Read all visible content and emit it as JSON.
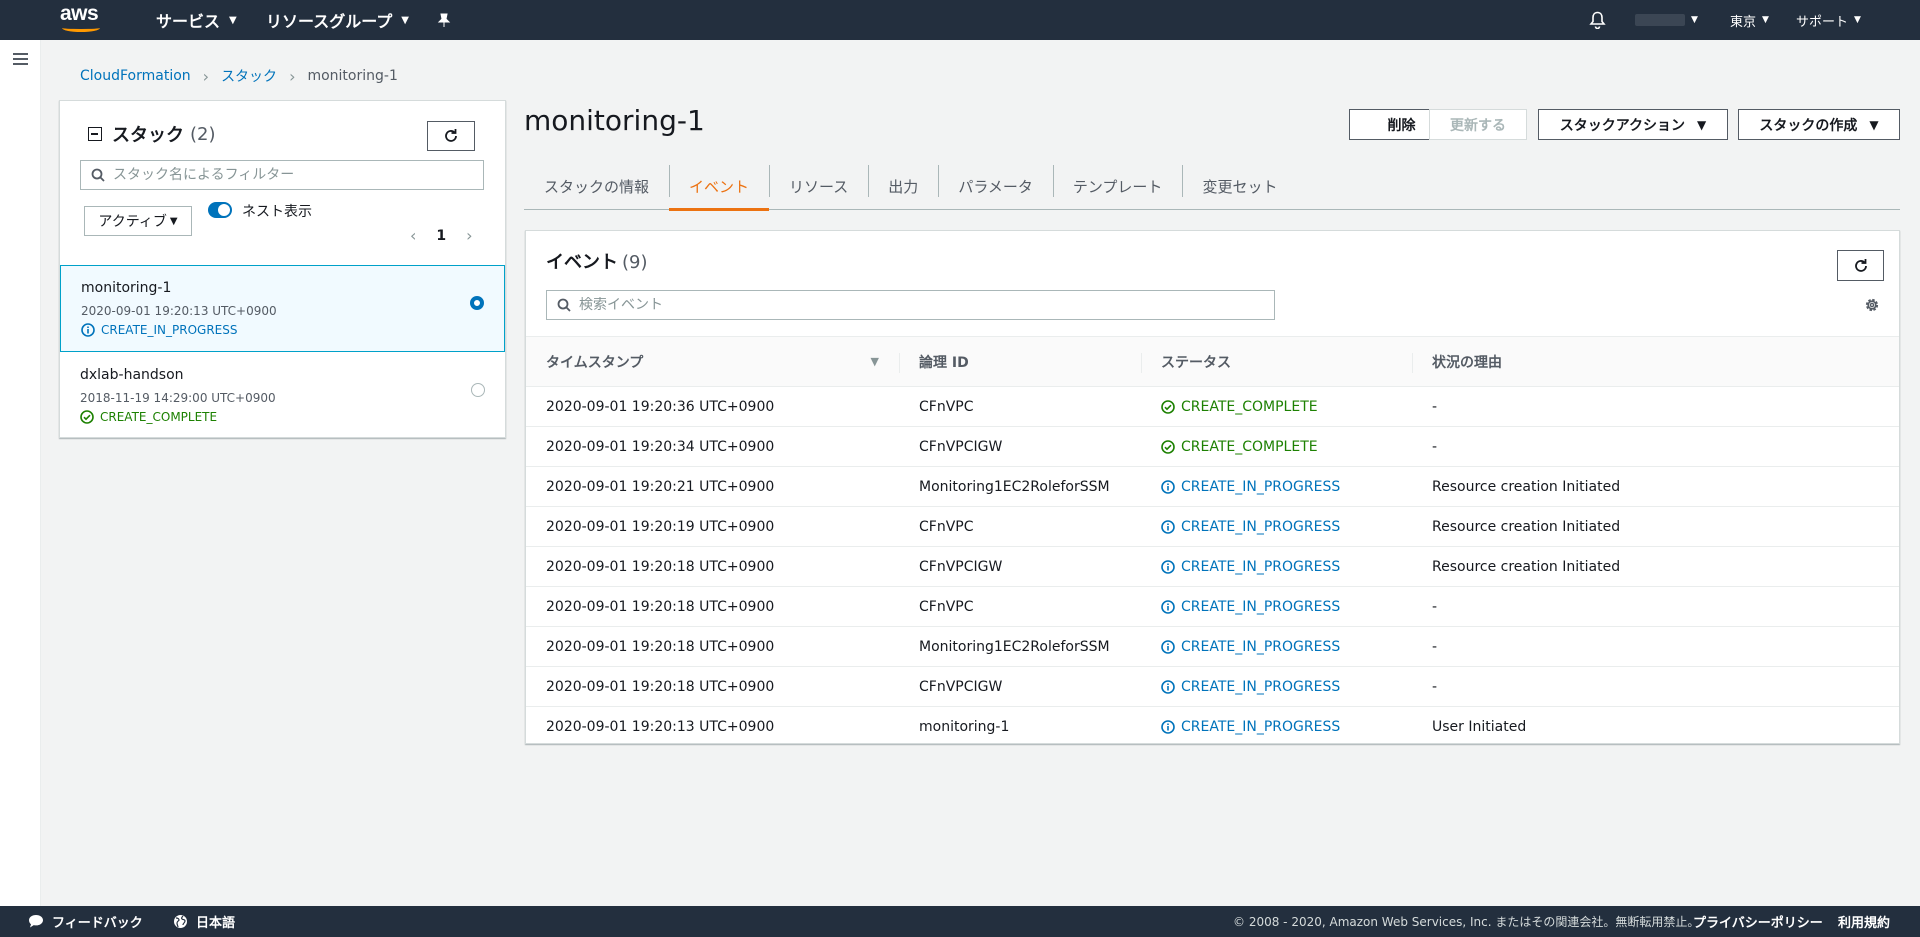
{
  "topnav": {
    "logo_text": "aws",
    "services": "サービス",
    "resource_groups": "リソースグループ",
    "account": "",
    "region": "東京",
    "support": "サポート"
  },
  "breadcrumb": {
    "root": "CloudFormation",
    "stacks": "スタック",
    "current": "monitoring-1"
  },
  "stacks_panel": {
    "title": "スタック",
    "count": "(2)",
    "search_placeholder": "スタック名によるフィルター",
    "filter_label": "アクティブ",
    "nested_label": "ネスト表示",
    "page": "1",
    "items": [
      {
        "name": "monitoring-1",
        "timestamp": "2020-09-01 19:20:13 UTC+0900",
        "status": "CREATE_IN_PROGRESS"
      },
      {
        "name": "dxlab-handson",
        "timestamp": "2018-11-19 14:29:00 UTC+0900",
        "status": "CREATE_COMPLETE"
      }
    ]
  },
  "main": {
    "title": "monitoring-1",
    "buttons": {
      "delete": "削除",
      "update": "更新する",
      "stack_actions": "スタックアクション",
      "create_stack": "スタックの作成"
    },
    "tabs": [
      "スタックの情報",
      "イベント",
      "リソース",
      "出力",
      "パラメータ",
      "テンプレート",
      "変更セット"
    ],
    "active_tab": "イベント"
  },
  "events": {
    "title": "イベント",
    "count": "(9)",
    "search_placeholder": "検索イベント",
    "columns": [
      "タイムスタンプ",
      "論理 ID",
      "ステータス",
      "状況の理由"
    ],
    "rows": [
      {
        "timestamp": "2020-09-01 19:20:36 UTC+0900",
        "logical_id": "CFnVPC",
        "status": "CREATE_COMPLETE",
        "reason": "-"
      },
      {
        "timestamp": "2020-09-01 19:20:34 UTC+0900",
        "logical_id": "CFnVPCIGW",
        "status": "CREATE_COMPLETE",
        "reason": "-"
      },
      {
        "timestamp": "2020-09-01 19:20:21 UTC+0900",
        "logical_id": "Monitoring1EC2RoleforSSM",
        "status": "CREATE_IN_PROGRESS",
        "reason": "Resource creation Initiated"
      },
      {
        "timestamp": "2020-09-01 19:20:19 UTC+0900",
        "logical_id": "CFnVPC",
        "status": "CREATE_IN_PROGRESS",
        "reason": "Resource creation Initiated"
      },
      {
        "timestamp": "2020-09-01 19:20:18 UTC+0900",
        "logical_id": "CFnVPCIGW",
        "status": "CREATE_IN_PROGRESS",
        "reason": "Resource creation Initiated"
      },
      {
        "timestamp": "2020-09-01 19:20:18 UTC+0900",
        "logical_id": "CFnVPC",
        "status": "CREATE_IN_PROGRESS",
        "reason": "-"
      },
      {
        "timestamp": "2020-09-01 19:20:18 UTC+0900",
        "logical_id": "Monitoring1EC2RoleforSSM",
        "status": "CREATE_IN_PROGRESS",
        "reason": "-"
      },
      {
        "timestamp": "2020-09-01 19:20:18 UTC+0900",
        "logical_id": "CFnVPCIGW",
        "status": "CREATE_IN_PROGRESS",
        "reason": "-"
      },
      {
        "timestamp": "2020-09-01 19:20:13 UTC+0900",
        "logical_id": "monitoring-1",
        "status": "CREATE_IN_PROGRESS",
        "reason": "User Initiated"
      }
    ]
  },
  "footer": {
    "feedback": "フィードバック",
    "language": "日本語",
    "copyright": "© 2008 - 2020, Amazon Web Services, Inc. またはその関連会社。無断転用禁止。",
    "privacy": "プライバシーポリシー",
    "terms": "利用規約"
  },
  "colors": {
    "nav_bg": "#232f3e",
    "accent_orange": "#ec7211",
    "link_blue": "#0073bb",
    "success_green": "#1d8102"
  }
}
